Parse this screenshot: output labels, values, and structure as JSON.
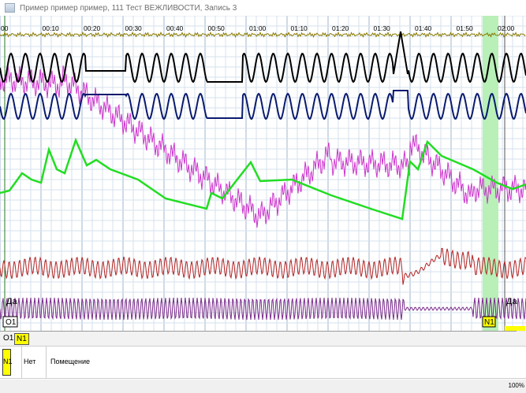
{
  "window": {
    "title": "Пример пример пример, 111 Тест ВЕЖЛИВОСТИ, Запись 3"
  },
  "timeline": {
    "ticks": [
      "00",
      "00:10",
      "00:20",
      "00:30",
      "00:40",
      "00:50",
      "01:00",
      "01:10",
      "01:20",
      "01:30",
      "01:40",
      "01:50",
      "02:00"
    ]
  },
  "markers": {
    "answer_left": "Да",
    "answer_right": "Да",
    "question_left": "О1",
    "question_right": "N1"
  },
  "marker_row": {
    "o1": "О1",
    "n1": "N1"
  },
  "question_table": {
    "code": "N1",
    "answer": "Нет",
    "text": "Помещение"
  },
  "status": {
    "zoom": "100%"
  },
  "colors": {
    "pneumo_upper": "#000000",
    "pneumo_lower": "#0a1a6e",
    "gsr": "#22dd22",
    "plethysmo": "#cc33cc",
    "tremor": "#8a7a00",
    "cardio": "#b22222",
    "motion": "#7a2a8a",
    "highlight": "#b8f0b8"
  }
}
